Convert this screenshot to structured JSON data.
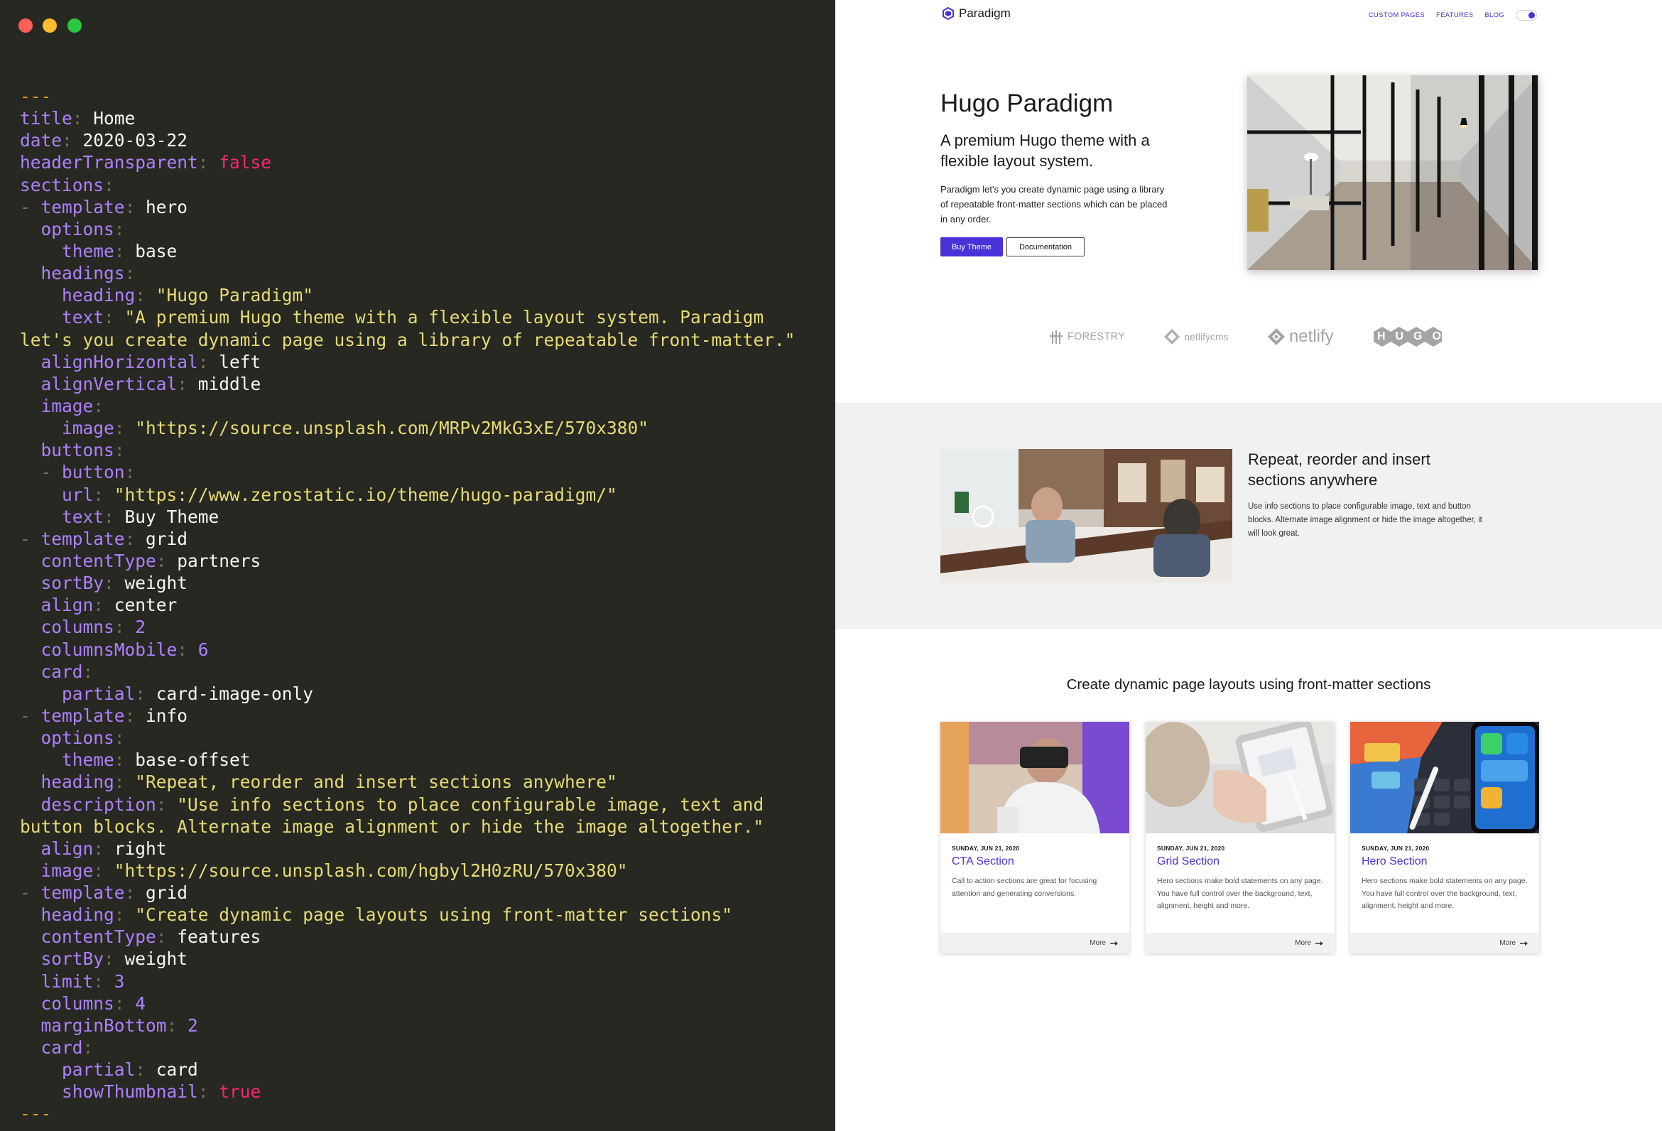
{
  "editor": {
    "code_lines": [
      [
        [
          "d",
          "---"
        ]
      ],
      [
        [
          "k",
          "title"
        ],
        [
          "p",
          ": "
        ],
        [
          "v",
          "Home"
        ]
      ],
      [
        [
          "k",
          "date"
        ],
        [
          "p",
          ": "
        ],
        [
          "v",
          "2020-03-22"
        ]
      ],
      [
        [
          "k",
          "headerTransparent"
        ],
        [
          "p",
          ": "
        ],
        [
          "b",
          "false"
        ]
      ],
      [
        [
          "k",
          "sections"
        ],
        [
          "p",
          ":"
        ]
      ],
      [
        [
          "p",
          "- "
        ],
        [
          "k",
          "template"
        ],
        [
          "p",
          ": "
        ],
        [
          "v",
          "hero"
        ]
      ],
      [
        [
          "v",
          "  "
        ],
        [
          "k",
          "options"
        ],
        [
          "p",
          ":"
        ]
      ],
      [
        [
          "v",
          "    "
        ],
        [
          "k",
          "theme"
        ],
        [
          "p",
          ": "
        ],
        [
          "v",
          "base"
        ]
      ],
      [
        [
          "v",
          "  "
        ],
        [
          "k",
          "headings"
        ],
        [
          "p",
          ":"
        ]
      ],
      [
        [
          "v",
          "    "
        ],
        [
          "k",
          "heading"
        ],
        [
          "p",
          ": "
        ],
        [
          "s",
          "\"Hugo Paradigm\""
        ]
      ],
      [
        [
          "v",
          "    "
        ],
        [
          "k",
          "text"
        ],
        [
          "p",
          ": "
        ],
        [
          "s",
          "\"A premium Hugo theme with a flexible layout system. Paradigm"
        ]
      ],
      [
        [
          "s",
          "let's you create dynamic page using a library of repeatable front-matter.\""
        ]
      ],
      [
        [
          "v",
          "  "
        ],
        [
          "k",
          "alignHorizontal"
        ],
        [
          "p",
          ": "
        ],
        [
          "v",
          "left"
        ]
      ],
      [
        [
          "v",
          "  "
        ],
        [
          "k",
          "alignVertical"
        ],
        [
          "p",
          ": "
        ],
        [
          "v",
          "middle"
        ]
      ],
      [
        [
          "v",
          "  "
        ],
        [
          "k",
          "image"
        ],
        [
          "p",
          ":"
        ]
      ],
      [
        [
          "v",
          "    "
        ],
        [
          "k",
          "image"
        ],
        [
          "p",
          ": "
        ],
        [
          "s",
          "\"https://source.unsplash.com/MRPv2MkG3xE/570x380\""
        ]
      ],
      [
        [
          "v",
          "  "
        ],
        [
          "k",
          "buttons"
        ],
        [
          "p",
          ":"
        ]
      ],
      [
        [
          "v",
          "  "
        ],
        [
          "p",
          "- "
        ],
        [
          "k",
          "button"
        ],
        [
          "p",
          ":"
        ]
      ],
      [
        [
          "v",
          "    "
        ],
        [
          "k",
          "url"
        ],
        [
          "p",
          ": "
        ],
        [
          "s",
          "\"https://www.zerostatic.io/theme/hugo-paradigm/\""
        ]
      ],
      [
        [
          "v",
          "    "
        ],
        [
          "k",
          "text"
        ],
        [
          "p",
          ": "
        ],
        [
          "v",
          "Buy Theme"
        ]
      ],
      [
        [
          "p",
          "- "
        ],
        [
          "k",
          "template"
        ],
        [
          "p",
          ": "
        ],
        [
          "v",
          "grid"
        ]
      ],
      [
        [
          "v",
          "  "
        ],
        [
          "k",
          "contentType"
        ],
        [
          "p",
          ": "
        ],
        [
          "v",
          "partners"
        ]
      ],
      [
        [
          "v",
          "  "
        ],
        [
          "k",
          "sortBy"
        ],
        [
          "p",
          ": "
        ],
        [
          "v",
          "weight"
        ]
      ],
      [
        [
          "v",
          "  "
        ],
        [
          "k",
          "align"
        ],
        [
          "p",
          ": "
        ],
        [
          "v",
          "center"
        ]
      ],
      [
        [
          "v",
          "  "
        ],
        [
          "k",
          "columns"
        ],
        [
          "p",
          ": "
        ],
        [
          "n",
          "2"
        ]
      ],
      [
        [
          "v",
          "  "
        ],
        [
          "k",
          "columnsMobile"
        ],
        [
          "p",
          ": "
        ],
        [
          "n",
          "6"
        ]
      ],
      [
        [
          "v",
          "  "
        ],
        [
          "k",
          "card"
        ],
        [
          "p",
          ":"
        ]
      ],
      [
        [
          "v",
          "    "
        ],
        [
          "k",
          "partial"
        ],
        [
          "p",
          ": "
        ],
        [
          "v",
          "card-image-only"
        ]
      ],
      [
        [
          "p",
          "- "
        ],
        [
          "k",
          "template"
        ],
        [
          "p",
          ": "
        ],
        [
          "v",
          "info"
        ]
      ],
      [
        [
          "v",
          "  "
        ],
        [
          "k",
          "options"
        ],
        [
          "p",
          ":"
        ]
      ],
      [
        [
          "v",
          "    "
        ],
        [
          "k",
          "theme"
        ],
        [
          "p",
          ": "
        ],
        [
          "v",
          "base-offset"
        ]
      ],
      [
        [
          "v",
          "  "
        ],
        [
          "k",
          "heading"
        ],
        [
          "p",
          ": "
        ],
        [
          "s",
          "\"Repeat, reorder and insert sections anywhere\""
        ]
      ],
      [
        [
          "v",
          "  "
        ],
        [
          "k",
          "description"
        ],
        [
          "p",
          ": "
        ],
        [
          "s",
          "\"Use info sections to place configurable image, text and"
        ]
      ],
      [
        [
          "s",
          "button blocks. Alternate image alignment or hide the image altogether.\""
        ]
      ],
      [
        [
          "v",
          "  "
        ],
        [
          "k",
          "align"
        ],
        [
          "p",
          ": "
        ],
        [
          "v",
          "right"
        ]
      ],
      [
        [
          "v",
          "  "
        ],
        [
          "k",
          "image"
        ],
        [
          "p",
          ": "
        ],
        [
          "s",
          "\"https://source.unsplash.com/hgbyl2H0zRU/570x380\""
        ]
      ],
      [
        [
          "p",
          "- "
        ],
        [
          "k",
          "template"
        ],
        [
          "p",
          ": "
        ],
        [
          "v",
          "grid"
        ]
      ],
      [
        [
          "v",
          "  "
        ],
        [
          "k",
          "heading"
        ],
        [
          "p",
          ": "
        ],
        [
          "s",
          "\"Create dynamic page layouts using front-matter sections\""
        ]
      ],
      [
        [
          "v",
          "  "
        ],
        [
          "k",
          "contentType"
        ],
        [
          "p",
          ": "
        ],
        [
          "v",
          "features"
        ]
      ],
      [
        [
          "v",
          "  "
        ],
        [
          "k",
          "sortBy"
        ],
        [
          "p",
          ": "
        ],
        [
          "v",
          "weight"
        ]
      ],
      [
        [
          "v",
          "  "
        ],
        [
          "k",
          "limit"
        ],
        [
          "p",
          ": "
        ],
        [
          "n",
          "3"
        ]
      ],
      [
        [
          "v",
          "  "
        ],
        [
          "k",
          "columns"
        ],
        [
          "p",
          ": "
        ],
        [
          "n",
          "4"
        ]
      ],
      [
        [
          "v",
          "  "
        ],
        [
          "k",
          "marginBottom"
        ],
        [
          "p",
          ": "
        ],
        [
          "n",
          "2"
        ]
      ],
      [
        [
          "v",
          "  "
        ],
        [
          "k",
          "card"
        ],
        [
          "p",
          ":"
        ]
      ],
      [
        [
          "v",
          "    "
        ],
        [
          "k",
          "partial"
        ],
        [
          "p",
          ": "
        ],
        [
          "v",
          "card"
        ]
      ],
      [
        [
          "v",
          "    "
        ],
        [
          "k",
          "showThumbnail"
        ],
        [
          "p",
          ": "
        ],
        [
          "b",
          "true"
        ]
      ],
      [
        [
          "d",
          "---"
        ]
      ]
    ],
    "colors": {
      "background": "#272822",
      "key": "#ae81ff",
      "punct": "#75715e",
      "string": "#e6db74",
      "bool": "#f92672",
      "delimiter": "#fd971f",
      "plain": "#f8f8f2"
    },
    "traffic_lights": {
      "close": "#ff5f57",
      "minimize": "#febc2e",
      "zoom": "#28c840"
    }
  },
  "site": {
    "brand": "Paradigm",
    "nav": [
      "CUSTOM PAGES",
      "FEATURES",
      "BLOG"
    ],
    "accent": "#4a32d9",
    "hero": {
      "title": "Hugo Paradigm",
      "subtitle": "A premium Hugo theme with a flexible layout system.",
      "text": "Paradigm let's you create dynamic page using a library of repeatable front-matter sections which can be placed in any order.",
      "button_primary": "Buy Theme",
      "button_secondary": "Documentation"
    },
    "partners": [
      "FORESTRY",
      "netlifycms",
      "netlify",
      "HUGO"
    ],
    "info": {
      "title": "Repeat, reorder and insert sections anywhere",
      "description": "Use info sections to place configurable image, text and button blocks. Alternate image alignment or hide the image altogether, it will look great."
    },
    "grid": {
      "title": "Create dynamic page layouts using front-matter sections",
      "cards": [
        {
          "date": "SUNDAY, JUN 21, 2020",
          "title": "CTA Section",
          "desc": "Call to action sections are great for focusing attention and generating conversions.",
          "more": "More"
        },
        {
          "date": "SUNDAY, JUN 21, 2020",
          "title": "Grid Section",
          "desc": "Hero sections make bold statements on any page. You have full control over the background, text, alignment, height and more.",
          "more": "More"
        },
        {
          "date": "SUNDAY, JUN 21, 2020",
          "title": "Hero Section",
          "desc": "Hero sections make bold statements on any page. You have full control over the background, text, alignment, height and more.",
          "more": "More"
        }
      ]
    }
  }
}
